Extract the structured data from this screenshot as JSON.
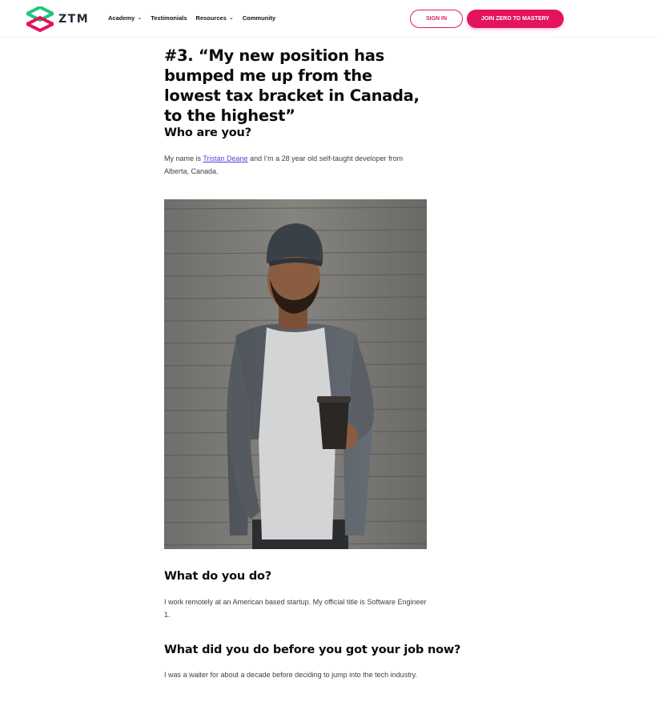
{
  "header": {
    "logo_text": "ZTM",
    "nav": [
      {
        "label": "Academy",
        "has_dropdown": true
      },
      {
        "label": "Testimonials",
        "has_dropdown": false
      },
      {
        "label": "Resources",
        "has_dropdown": true
      },
      {
        "label": "Community",
        "has_dropdown": false
      }
    ],
    "signin_label": "SIGN IN",
    "join_label": "JOIN ZERO TO MASTERY"
  },
  "article": {
    "title": "#3. “My new position has bumped me up from the lowest tax bracket in Canada, to the highest”",
    "sections": [
      {
        "heading": "Who are you?",
        "text_before_link": "My name is ",
        "link_text": "Tristan Deane",
        "text_after_link": " and I’m a 28 year old self-taught developer from Alberta, Canada."
      },
      {
        "heading": "What do you do?",
        "text": "I work remotely at an American based startup. My official title is Software Engineer 1."
      },
      {
        "heading": "What did you do before you got your job now?",
        "text": "I was a waiter for about a decade before deciding to jump into the tech industry."
      }
    ]
  },
  "colors": {
    "brand_pink": "#e3135d",
    "brand_green": "#21c47b",
    "link": "#5b3fd6"
  }
}
